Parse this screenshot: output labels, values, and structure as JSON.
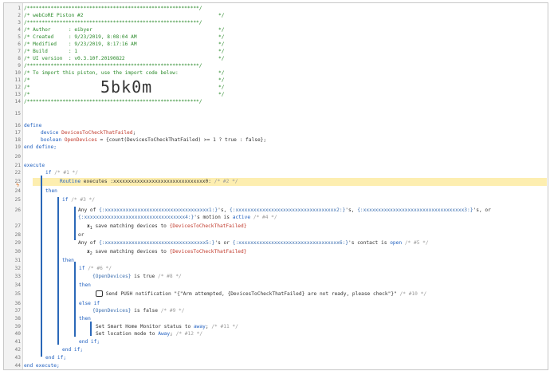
{
  "header": {
    "title": "/* webCoRE Piston #2",
    "author": "/* Author      : eibyer",
    "created": "/* Created     : 9/23/2019, 8:08:04 AM",
    "modified": "/* Modified    : 9/23/2019, 8:17:16 AM",
    "build": "/* Build       : 1",
    "ui_version": "/* UI version  : v0.3.10f.20190822",
    "import_line": "/* To import this piston, use the import code below:",
    "import_code": "5bk0m"
  },
  "lines": [
    "1",
    "2",
    "3",
    "4",
    "5",
    "6",
    "7",
    "8",
    "9",
    "10",
    "11",
    "12",
    "13",
    "14",
    "15",
    "16",
    "17",
    "18",
    "19",
    "20",
    "21",
    "22",
    "23",
    "24",
    "25",
    "26",
    "27",
    "28",
    "29",
    "30",
    "31",
    "32",
    "33",
    "34",
    "35",
    "36",
    "37",
    "38",
    "39",
    "40",
    "41",
    "42",
    "43",
    "44"
  ],
  "code": {
    "star_line": "/**********************************************************/",
    "comment_end": "*/",
    "comment_mark": "/*",
    "define": "define",
    "device_kw": "device",
    "device_var": "DevicesToCheckThatFailed",
    "boolean_kw": "boolean",
    "bool_var": "OpenDevices",
    "bool_expr": " = {count(DevicesToCheckThatFailed) >= 1 ? true : false};",
    "end_define": "end define;",
    "execute": "execute",
    "if1": "if",
    "if1_comment": "/* #1 */",
    "routine_kw": "Routine",
    "routine_text": " executes :xxxxxxxxxxxxxxxxxxxxxxxxxxxxxxx0:",
    "routine_comment": "/* #2 */",
    "then": "then",
    "if3": "if",
    "if3_comment": "/* #3 */",
    "any_of_1": "Any of ",
    "dev1": "{:xxxxxxxxxxxxxxxxxxxxxxxxxxxxxxxxxxx1:}",
    "s_comma": "'s, ",
    "dev2": "{:xxxxxxxxxxxxxxxxxxxxxxxxxxxxxxxxxx2:}",
    "dev3": "{:xxxxxxxxxxxxxxxxxxxxxxxxxxxxxxxxxx3:}",
    "s_comma_or": "'s, or",
    "dev4": "{:xxxxxxxxxxxxxxxxxxxxxxxxxxxxxxxxxx4:}",
    "motion_text": "'s motion is ",
    "active": "active",
    "c4": "/* #4 */",
    "save_text": "save matching devices to ",
    "save_var": "{DevicesToCheckThatFailed}",
    "or": "or",
    "any_of_2": "Any of ",
    "dev5": "{:xxxxxxxxxxxxxxxxxxxxxxxxxxxxxxxxxx5:}",
    "s_or": "'s or ",
    "dev6": "{:xxxxxxxxxxxxxxxxxxxxxxxxxxxxxxxxxx6:}",
    "contact_text": "'s contact is ",
    "open": "open",
    "c5": "/* #5 */",
    "if6_comment": "/* #6 */",
    "open_devices": "{OpenDevices}",
    "is_true": " is true ",
    "c8": "/* #8 */",
    "push_text": "Send PUSH notification ",
    "push_msg": "\"{\"Arm attempted, {DevicesToCheckThatFailed} are not ready, please check\"}\"",
    "c10": "/* #10 */",
    "else_if": "else if",
    "is_false": " is false ",
    "c9": "/* #9 */",
    "shm_text": "Set Smart Home Monitor status to ",
    "away": "away",
    "c11": "/* #11 */",
    "mode_text": "Set location mode to ",
    "away_mode": "Away",
    "c12": "/* #12 */",
    "end_if": "end if;",
    "end_execute": "end execute;",
    "semi": ";",
    "x1": "x",
    "sub1": "1",
    "x2": "x",
    "sub2": "2"
  }
}
